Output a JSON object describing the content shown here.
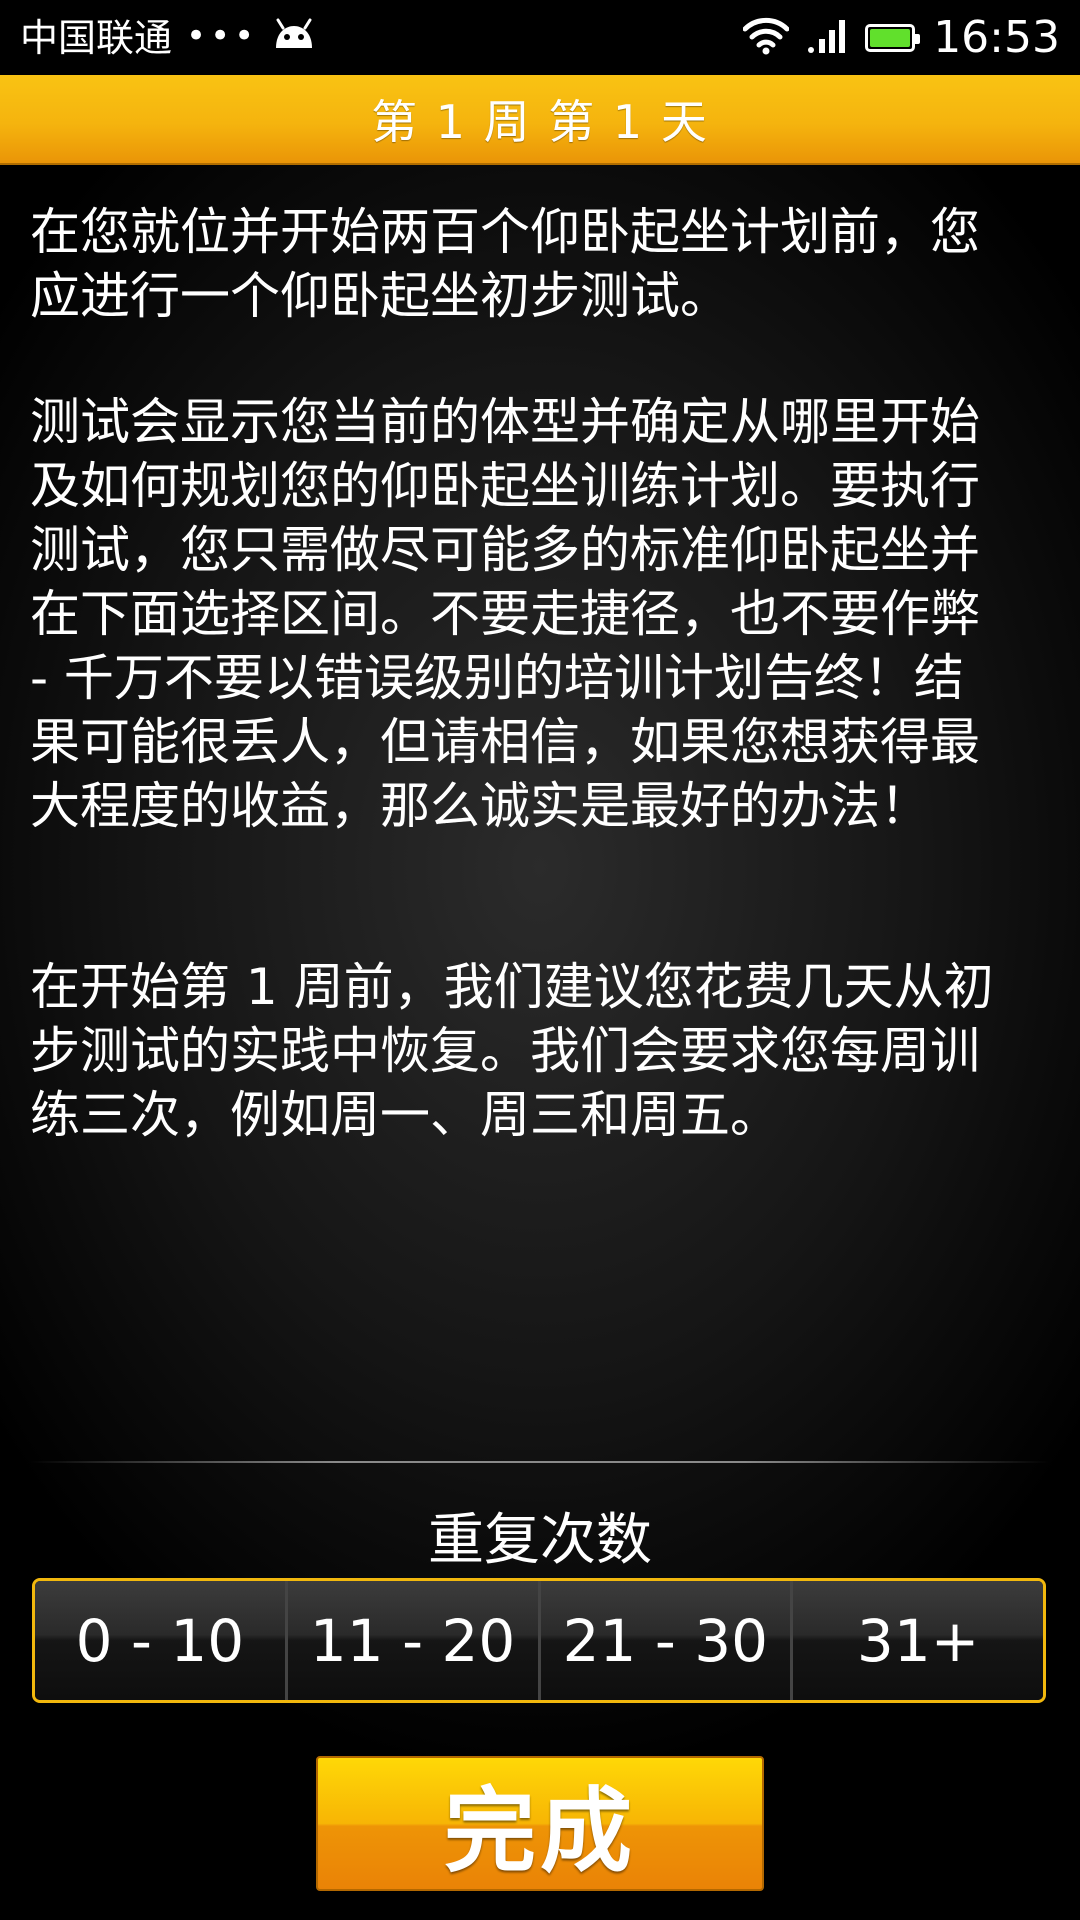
{
  "status_bar": {
    "carrier": "中国联通",
    "dots": "•••",
    "time": "16:53",
    "battery_color": "#61e02c"
  },
  "header": {
    "title": "第 1 周 第 1 天"
  },
  "body": {
    "paragraphs": [
      "在您就位并开始两百个仰卧起坐计划前，您应进行一个仰卧起坐初步测试。",
      "测试会显示您当前的体型并确定从哪里开始及如何规划您的仰卧起坐训练计划。要执行测试，您只需做尽可能多的标准仰卧起坐并在下面选择区间。不要走捷径，也不要作弊 - 千万不要以错误级别的培训计划告终！结果可能很丢人，但请相信，如果您想获得最大程度的收益，那么诚实是最好的办法！",
      "在开始第 1 周前，我们建议您花费几天从初步测试的实践中恢复。我们会要求您每周训练三次，例如周一、周三和周五。"
    ]
  },
  "reps": {
    "label": "重复次数",
    "options": [
      "0 - 10",
      "11 - 20",
      "21 - 30",
      "31+"
    ]
  },
  "footer": {
    "done_label": "完成"
  },
  "colors": {
    "accent": "#f5b40e",
    "accent_dark": "#ea8306",
    "text": "#ffffff"
  }
}
